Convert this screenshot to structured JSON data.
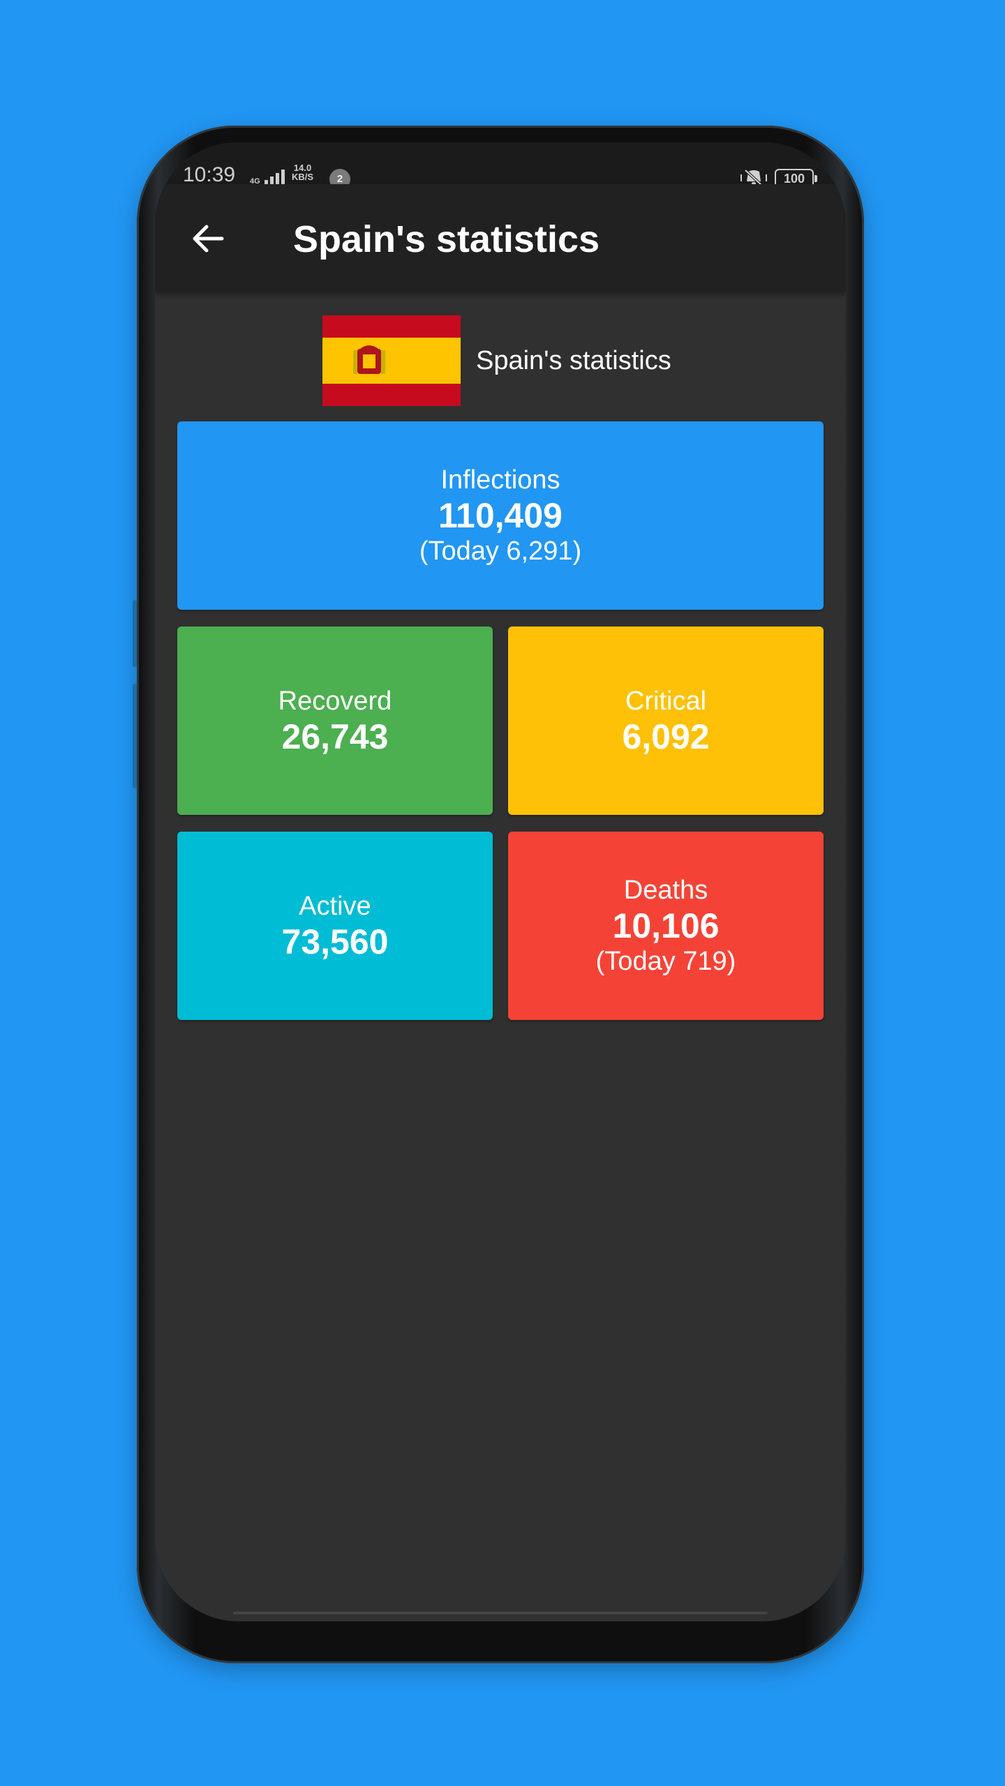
{
  "status_bar": {
    "time": "10:39",
    "network": "4G",
    "speed_value": "14.0",
    "speed_unit": "KB/S",
    "notification_count": "2",
    "battery": "100",
    "icons": [
      "signal-icon",
      "mute-icon",
      "battery-icon"
    ]
  },
  "app_bar": {
    "back_icon": "arrow-left-icon",
    "title": "Spain's statistics"
  },
  "country": {
    "flag_icon": "spain-flag-icon",
    "label": "Spain's statistics"
  },
  "stats": {
    "infections": {
      "label": "Inflections",
      "value": "110,409",
      "today": "(Today 6,291)",
      "color": "#2196F3"
    },
    "recovered": {
      "label": "Recoverd",
      "value": "26,743",
      "color": "#4CAF50"
    },
    "critical": {
      "label": "Critical",
      "value": "6,092",
      "color": "#FFC107"
    },
    "active": {
      "label": "Active",
      "value": "73,560",
      "color": "#00BCD4"
    },
    "deaths": {
      "label": "Deaths",
      "value": "10,106",
      "today": "(Today 719)",
      "color": "#F44336"
    }
  },
  "colors": {
    "background": "#2196F3",
    "screen_bg": "#303030",
    "app_bar_bg": "#212121",
    "status_bar_bg": "#1b1b1b"
  }
}
